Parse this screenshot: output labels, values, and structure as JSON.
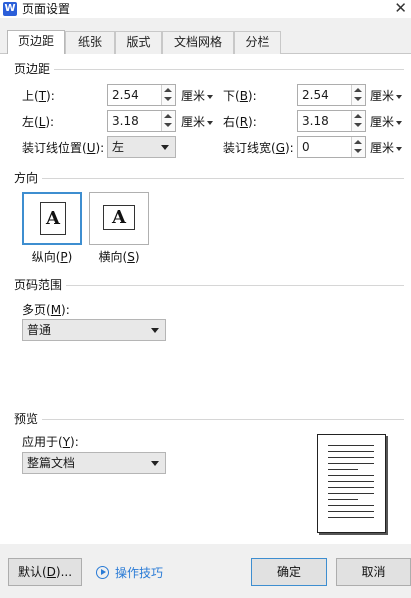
{
  "window": {
    "app_icon": "W",
    "title": "页面设置",
    "close_glyph": "✕"
  },
  "tabs": [
    {
      "label": "页边距",
      "active": true
    },
    {
      "label": "纸张"
    },
    {
      "label": "版式"
    },
    {
      "label": "文档网格"
    },
    {
      "label": "分栏"
    }
  ],
  "margins": {
    "section": "页边距",
    "top": {
      "label": "上(",
      "key": "T",
      "tail": "):",
      "value": "2.54",
      "unit": "厘米"
    },
    "bottom": {
      "label": "下(",
      "key": "B",
      "tail": "):",
      "value": "2.54",
      "unit": "厘米"
    },
    "left": {
      "label": "左(",
      "key": "L",
      "tail": "):",
      "value": "3.18",
      "unit": "厘米"
    },
    "right": {
      "label": "右(",
      "key": "R",
      "tail": "):",
      "value": "3.18",
      "unit": "厘米"
    },
    "gutter_pos": {
      "label": "装订线位置(",
      "key": "U",
      "tail": "):",
      "value": "左"
    },
    "gutter": {
      "label": "装订线宽(",
      "key": "G",
      "tail": "):",
      "value": "0",
      "unit": "厘米"
    }
  },
  "orientation": {
    "section": "方向",
    "glyph": "A",
    "portrait": {
      "label": "纵向(",
      "key": "P",
      "tail": ")",
      "selected": true
    },
    "landscape": {
      "label": "横向(",
      "key": "S",
      "tail": ")"
    }
  },
  "page_range": {
    "section": "页码范围",
    "multi": {
      "label": "多页(",
      "key": "M",
      "tail": "):",
      "value": "普通"
    }
  },
  "preview": {
    "section": "预览",
    "apply_to": {
      "label": "应用于(",
      "key": "Y",
      "tail": "):",
      "value": "整篇文档"
    }
  },
  "footer": {
    "default_btn": {
      "label": "默认(",
      "key": "D",
      "tail": ")..."
    },
    "tips": "操作技巧",
    "ok": "确定",
    "cancel": "取消"
  },
  "colors": {
    "accent": "#3e8ed0",
    "link": "#2a7bd6",
    "app_icon": "#2b5fd9"
  }
}
